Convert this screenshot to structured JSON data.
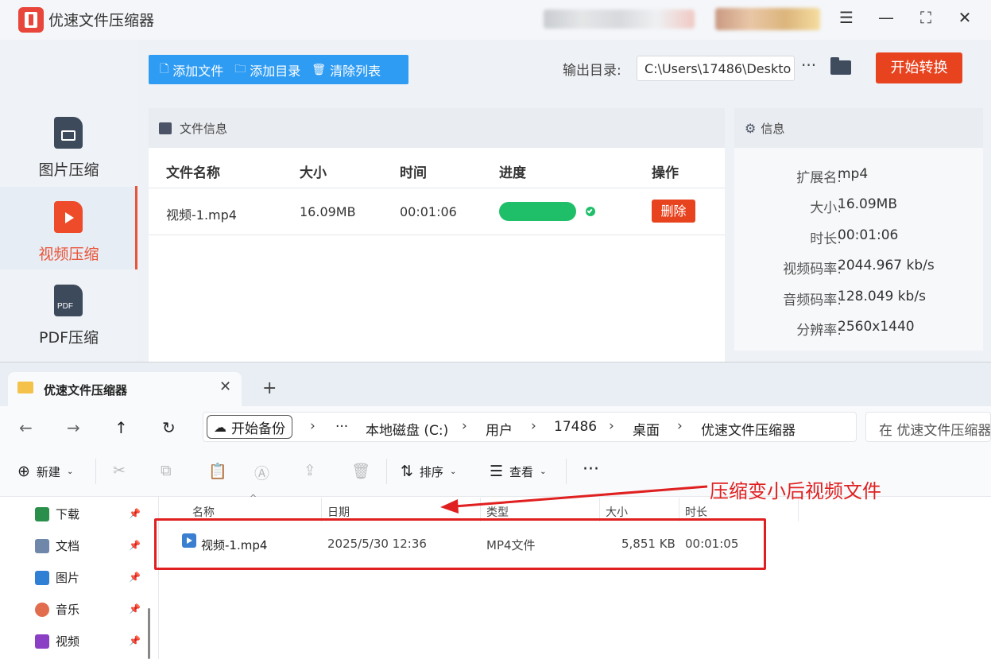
{
  "app": {
    "title": "优速文件压缩器",
    "accent": "#e8431f",
    "window_controls": [
      "menu-icon",
      "minimize-icon",
      "maximize-icon",
      "close-icon"
    ]
  },
  "sidebar": {
    "items": [
      {
        "label": "图片压缩",
        "icon": "image-file-icon",
        "active": false
      },
      {
        "label": "视频压缩",
        "icon": "video-file-icon",
        "active": true
      },
      {
        "label": "PDF压缩",
        "icon": "pdf-file-icon",
        "active": false
      }
    ],
    "pdf_icon_text": "PDF"
  },
  "toolbar": {
    "add_file": "添加文件",
    "add_folder": "添加目录",
    "clear_list": "清除列表",
    "output_label": "输出目录:",
    "output_path": "C:\\Users\\17486\\Deskto",
    "more": "···",
    "start": "开始转换"
  },
  "file_panel": {
    "title": "文件信息",
    "columns": [
      "文件名称",
      "大小",
      "时间",
      "进度",
      "操作"
    ],
    "rows": [
      {
        "name": "视频-1.mp4",
        "size": "16.09MB",
        "time": "00:01:06",
        "progress": 1.0,
        "action": "删除"
      }
    ]
  },
  "info_panel": {
    "title": "信息",
    "fields": [
      {
        "key": "扩展名:",
        "value": "mp4"
      },
      {
        "key": "大小:",
        "value": "16.09MB"
      },
      {
        "key": "时长:",
        "value": "00:01:06"
      },
      {
        "key": "视频码率:",
        "value": "2044.967 kb/s"
      },
      {
        "key": "音频码率:",
        "value": "128.049 kb/s"
      },
      {
        "key": "分辨率:",
        "value": "2560x1440"
      }
    ]
  },
  "explorer": {
    "tab_title": "优速文件压缩器",
    "new_tab": "+",
    "backup": "开始备份",
    "breadcrumbs": [
      "···",
      "本地磁盘 (C:)",
      "用户",
      "17486",
      "桌面",
      "优速文件压缩器"
    ],
    "search_placeholder": "在 优速文件压缩器",
    "commands": {
      "new": "新建",
      "sort": "排序",
      "view": "查看",
      "more": "···"
    },
    "quick_access": [
      {
        "label": "下载",
        "icon": "download-icon",
        "color": "#2a8f4a"
      },
      {
        "label": "文档",
        "icon": "document-icon",
        "color": "#6f87a8"
      },
      {
        "label": "图片",
        "icon": "pictures-icon",
        "color": "#2f7fd4"
      },
      {
        "label": "音乐",
        "icon": "music-icon",
        "color": "#e26d4e"
      },
      {
        "label": "视频",
        "icon": "videos-icon",
        "color": "#8a3fc4"
      }
    ],
    "columns": [
      "名称",
      "日期",
      "类型",
      "大小",
      "时长"
    ],
    "files": [
      {
        "name": "视频-1.mp4",
        "date": "2025/5/30 12:36",
        "type": "MP4文件",
        "size": "5,851 KB",
        "duration": "00:01:05"
      }
    ]
  },
  "annotation": {
    "text": "压缩变小后视频文件",
    "color": "#e02020"
  }
}
